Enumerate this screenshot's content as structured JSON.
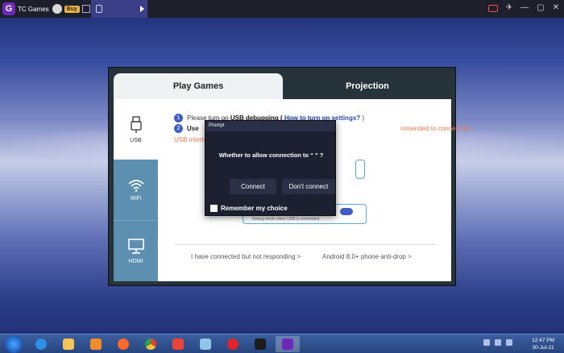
{
  "topbar": {
    "app_title": "TC Games",
    "buy_label": "Buy",
    "controls": [
      "record-icon",
      "pin-icon",
      "minimize-icon",
      "maximize-icon",
      "close-icon"
    ]
  },
  "tabs": {
    "play": "Play Games",
    "projection": "Projection"
  },
  "sidebar": {
    "items": [
      {
        "label": "USB",
        "icon": "usb-icon"
      },
      {
        "label": "WiFi",
        "icon": "wifi-icon"
      },
      {
        "label": "HDMI",
        "icon": "hdmi-icon"
      }
    ]
  },
  "steps": {
    "step1_num": "1",
    "step1_prefix": "Please turn on",
    "step1_bold": "USB debugging (",
    "step1_link": "How to turn on settings?",
    "step1_suffix": ")",
    "step2_num": "2",
    "step2_bold": "Use",
    "step2_warn_right": "mmended to connect the",
    "step2_warn_left": "USB interfa"
  },
  "options": {
    "debug_sub": "Debug mode when USB is connected"
  },
  "links": {
    "not_responding": "I have connected but not responding >",
    "anti_drop": "Android 8.0+ phone anti-drop >"
  },
  "prompt": {
    "title": "Prompt",
    "message": "Whether to allow connection to “ ” ?",
    "connect": "Connect",
    "dont_connect": "Don't connect",
    "remember": "Remember my choice"
  },
  "taskbar": {
    "time": "12:47 PM",
    "date": "30-Jul-21"
  },
  "colors": {
    "accent": "#3f5fc4",
    "sidebar_blue": "#5d8fb1",
    "warn": "#f07a4a"
  }
}
